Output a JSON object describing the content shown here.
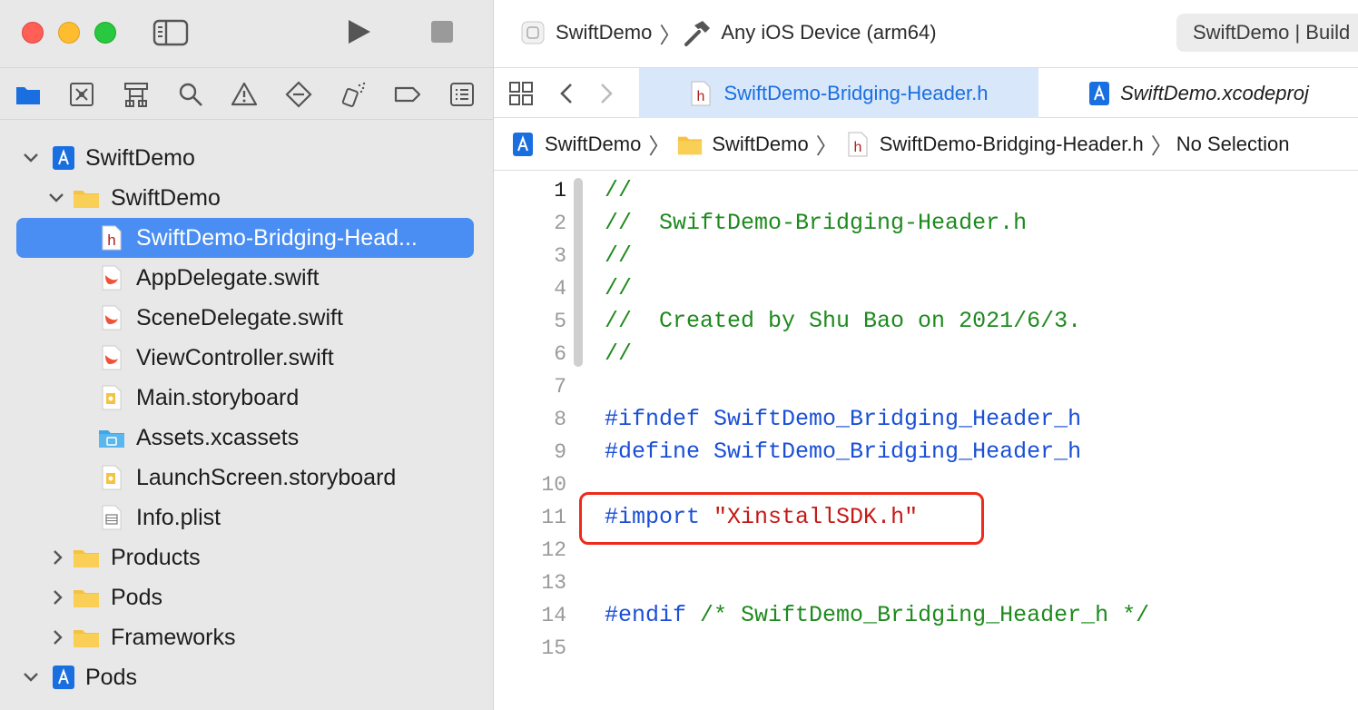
{
  "toolbar": {
    "scheme_project": "SwiftDemo",
    "scheme_device": "Any iOS Device (arm64)",
    "activity": "SwiftDemo | Build"
  },
  "navigator_tabs": [
    {
      "name": "project-navigator"
    },
    {
      "name": "source-control-navigator"
    },
    {
      "name": "symbol-navigator"
    },
    {
      "name": "find-navigator"
    },
    {
      "name": "issue-navigator"
    },
    {
      "name": "test-navigator"
    },
    {
      "name": "debug-navigator"
    },
    {
      "name": "breakpoint-navigator"
    },
    {
      "name": "report-navigator"
    }
  ],
  "tree": {
    "root_project": "SwiftDemo",
    "group_swiftdemo": "SwiftDemo",
    "files": [
      {
        "label": "SwiftDemo-Bridging-Head...",
        "icon": "header-file-icon",
        "selected": true
      },
      {
        "label": "AppDelegate.swift",
        "icon": "swift-file-icon"
      },
      {
        "label": "SceneDelegate.swift",
        "icon": "swift-file-icon"
      },
      {
        "label": "ViewController.swift",
        "icon": "swift-file-icon"
      },
      {
        "label": "Main.storyboard",
        "icon": "storyboard-file-icon"
      },
      {
        "label": "Assets.xcassets",
        "icon": "assets-folder-icon"
      },
      {
        "label": "LaunchScreen.storyboard",
        "icon": "storyboard-file-icon"
      },
      {
        "label": "Info.plist",
        "icon": "plist-file-icon"
      }
    ],
    "groups": [
      "Products",
      "Pods",
      "Frameworks"
    ],
    "pods_project": "Pods"
  },
  "tabs": {
    "active": "SwiftDemo-Bridging-Header.h",
    "second": "SwiftDemo.xcodeproj"
  },
  "jumpbar": {
    "project": "SwiftDemo",
    "group": "SwiftDemo",
    "file": "SwiftDemo-Bridging-Header.h",
    "selection": "No Selection"
  },
  "code": {
    "current_line": 1,
    "lines": [
      {
        "n": "1",
        "parts": [
          {
            "t": "//",
            "c": "comment"
          }
        ]
      },
      {
        "n": "2",
        "parts": [
          {
            "t": "//  SwiftDemo-Bridging-Header.h",
            "c": "comment"
          }
        ]
      },
      {
        "n": "3",
        "parts": [
          {
            "t": "//",
            "c": "comment"
          }
        ]
      },
      {
        "n": "4",
        "parts": [
          {
            "t": "//",
            "c": "comment"
          }
        ]
      },
      {
        "n": "5",
        "parts": [
          {
            "t": "//  Created by Shu Bao on 2021/6/3.",
            "c": "comment"
          }
        ]
      },
      {
        "n": "6",
        "parts": [
          {
            "t": "//",
            "c": "comment"
          }
        ]
      },
      {
        "n": "7",
        "parts": []
      },
      {
        "n": "8",
        "parts": [
          {
            "t": "#ifndef SwiftDemo_Bridging_Header_h",
            "c": "pre"
          }
        ]
      },
      {
        "n": "9",
        "parts": [
          {
            "t": "#define SwiftDemo_Bridging_Header_h",
            "c": "pre"
          }
        ]
      },
      {
        "n": "10",
        "parts": []
      },
      {
        "n": "11",
        "parts": [
          {
            "t": "#import ",
            "c": "pre"
          },
          {
            "t": "\"XinstallSDK.h\"",
            "c": "str"
          }
        ]
      },
      {
        "n": "12",
        "parts": []
      },
      {
        "n": "13",
        "parts": []
      },
      {
        "n": "14",
        "parts": [
          {
            "t": "#endif ",
            "c": "pre"
          },
          {
            "t": "/* SwiftDemo_Bridging_Header_h */",
            "c": "comment"
          }
        ]
      },
      {
        "n": "15",
        "parts": []
      }
    ]
  },
  "colors": {
    "selection": "#4a8ef3",
    "accent": "#1a6fe0",
    "comment": "#1e8a1e",
    "preprocessor": "#1a4fd6",
    "string": "#c41a16",
    "highlight_box": "#ee2a1b"
  }
}
